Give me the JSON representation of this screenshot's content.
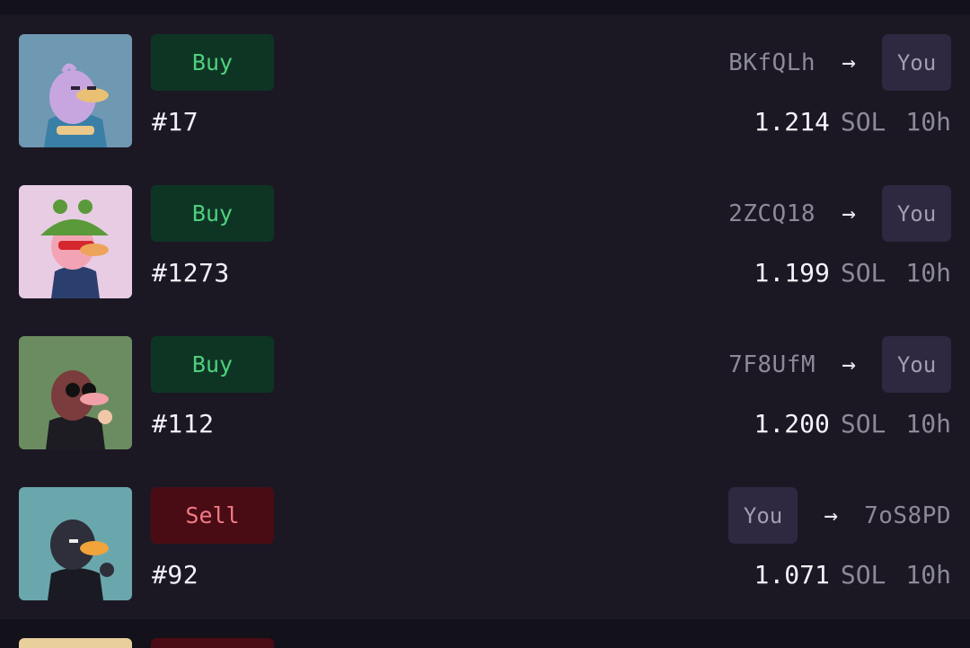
{
  "colors": {
    "background": "#1b1824",
    "buy_bg": "#0e3524",
    "buy_text": "#4fd07f",
    "sell_bg": "#4a0c14",
    "sell_text": "#f17a86",
    "you_chip_bg": "#2e2840"
  },
  "activity": [
    {
      "type": "Buy",
      "token_id": "#17",
      "from": "BKfQLh",
      "to": "You",
      "amount": "1.214",
      "currency": "SOL",
      "time": "10h",
      "arrow": "→"
    },
    {
      "type": "Buy",
      "token_id": "#1273",
      "from": "2ZCQ18",
      "to": "You",
      "amount": "1.199",
      "currency": "SOL",
      "time": "10h",
      "arrow": "→"
    },
    {
      "type": "Buy",
      "token_id": "#112",
      "from": "7F8UfM",
      "to": "You",
      "amount": "1.200",
      "currency": "SOL",
      "time": "10h",
      "arrow": "→"
    },
    {
      "type": "Sell",
      "token_id": "#92",
      "from": "You",
      "to": "7oS8PD",
      "amount": "1.071",
      "currency": "SOL",
      "time": "10h",
      "arrow": "→"
    }
  ]
}
